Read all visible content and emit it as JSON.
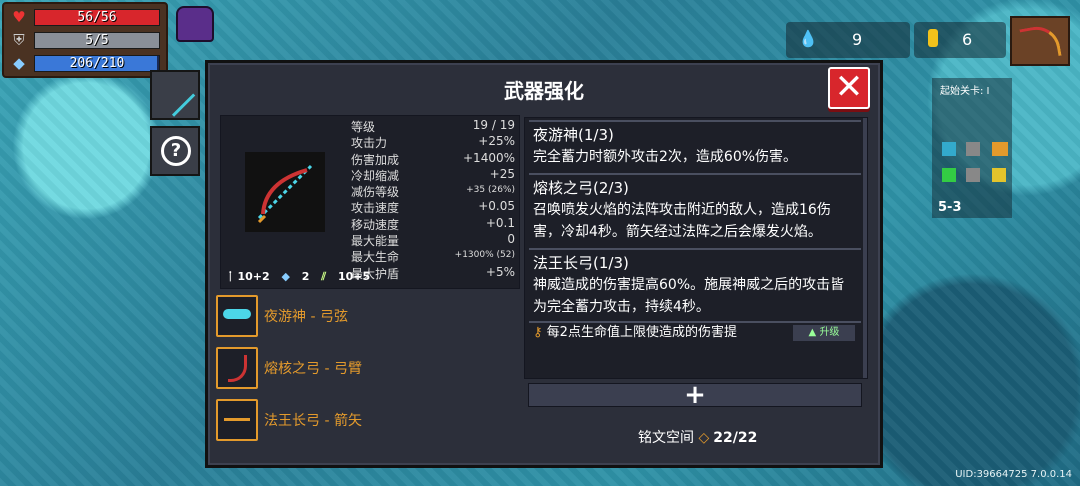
{
  "hud": {
    "hp": {
      "text": "56/56",
      "fraction": 1.0,
      "color": "#d8262c",
      "icon": "heart-icon"
    },
    "armor": {
      "text": "5/5",
      "fraction": 1.0,
      "color": "#8a8f98",
      "icon": "shield-icon"
    },
    "energy": {
      "text": "206/210",
      "fraction": 0.98,
      "color": "#3a78d8",
      "icon": "diamond-icon"
    }
  },
  "currency": {
    "gems": "9",
    "coins": "6"
  },
  "minimap": {
    "start_label": "起始关卡: I",
    "level": "5-3"
  },
  "dialog": {
    "title": "武器强化",
    "close_icon": "close-icon",
    "stats": [
      {
        "k": "等级",
        "v": "19 / 19"
      },
      {
        "k": "攻击力",
        "v": "+25%"
      },
      {
        "k": "伤害加成",
        "v": "+1400%"
      },
      {
        "k": "冷却缩减",
        "v": "+25"
      },
      {
        "k": "减伤等级",
        "v": "+35 (26%)"
      },
      {
        "k": "攻击速度",
        "v": "+0.05"
      },
      {
        "k": "移动速度",
        "v": "+0.1"
      },
      {
        "k": "最大能量",
        "v": "0"
      },
      {
        "k": "最大生命",
        "v": "+1300% (52)"
      },
      {
        "k": "最大护盾",
        "v": "+5%"
      }
    ],
    "materials": [
      "10+2",
      "2",
      "10+5"
    ],
    "parts": [
      {
        "label": "夜游神 - 弓弦",
        "icon": "bowstring-icon"
      },
      {
        "label": "熔核之弓 - 弓臂",
        "icon": "bow-limb-icon"
      },
      {
        "label": "法王长弓 - 箭矢",
        "icon": "arrow-icon"
      }
    ],
    "descriptions": [
      {
        "title": "夜游神(1/3)",
        "body": "完全蓄力时额外攻击2次，造成60%伤害。"
      },
      {
        "title": "熔核之弓(2/3)",
        "body": "召唤喷发火焰的法阵攻击附近的敌人，造成16伤害，冷却4秒。箭矢经过法阵之后会爆发火焰。"
      },
      {
        "title": "法王长弓(1/3)",
        "body": "神威造成的伤害提高60%。施展神威之后的攻击皆为完全蓄力攻击，持续4秒。"
      }
    ],
    "inscription_partial": "每2点生命值上限使造成的伤害提",
    "upgrade_label": "升级",
    "add_label": "+",
    "rune_space_label": "铭文空间",
    "rune_space_value": "22/22"
  },
  "uid": "UID:39664725 7.0.0.14"
}
